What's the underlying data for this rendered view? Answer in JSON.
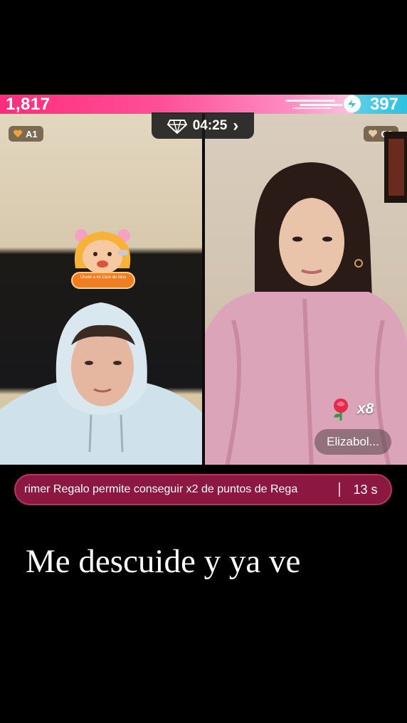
{
  "battle": {
    "left_score": "1,817",
    "right_score": "397",
    "timer": "04:25",
    "timer_chevron": "›",
    "colors": {
      "left": "#ff2d7a",
      "right": "#2ec0e0"
    }
  },
  "left_host": {
    "rank": "A1",
    "sticker_label": "Únete a mi Club de fans"
  },
  "right_host": {
    "rank": "C3",
    "gift_icon": "rose-icon",
    "gift_multiplier": "x8",
    "name_tag": "Elizabol..."
  },
  "ticker": {
    "message": "rimer Regalo permite conseguir x2 de puntos de Rega",
    "countdown": "13 s",
    "color": "#8c1740"
  },
  "caption": "Me descuide y ya ve"
}
